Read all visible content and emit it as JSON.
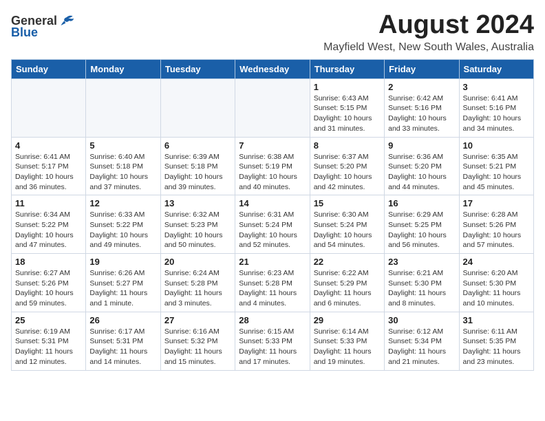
{
  "logo": {
    "general": "General",
    "blue": "Blue"
  },
  "title": "August 2024",
  "subtitle": "Mayfield West, New South Wales, Australia",
  "weekdays": [
    "Sunday",
    "Monday",
    "Tuesday",
    "Wednesday",
    "Thursday",
    "Friday",
    "Saturday"
  ],
  "weeks": [
    [
      {
        "day": "",
        "info": ""
      },
      {
        "day": "",
        "info": ""
      },
      {
        "day": "",
        "info": ""
      },
      {
        "day": "",
        "info": ""
      },
      {
        "day": "1",
        "info": "Sunrise: 6:43 AM\nSunset: 5:15 PM\nDaylight: 10 hours\nand 31 minutes."
      },
      {
        "day": "2",
        "info": "Sunrise: 6:42 AM\nSunset: 5:16 PM\nDaylight: 10 hours\nand 33 minutes."
      },
      {
        "day": "3",
        "info": "Sunrise: 6:41 AM\nSunset: 5:16 PM\nDaylight: 10 hours\nand 34 minutes."
      }
    ],
    [
      {
        "day": "4",
        "info": "Sunrise: 6:41 AM\nSunset: 5:17 PM\nDaylight: 10 hours\nand 36 minutes."
      },
      {
        "day": "5",
        "info": "Sunrise: 6:40 AM\nSunset: 5:18 PM\nDaylight: 10 hours\nand 37 minutes."
      },
      {
        "day": "6",
        "info": "Sunrise: 6:39 AM\nSunset: 5:18 PM\nDaylight: 10 hours\nand 39 minutes."
      },
      {
        "day": "7",
        "info": "Sunrise: 6:38 AM\nSunset: 5:19 PM\nDaylight: 10 hours\nand 40 minutes."
      },
      {
        "day": "8",
        "info": "Sunrise: 6:37 AM\nSunset: 5:20 PM\nDaylight: 10 hours\nand 42 minutes."
      },
      {
        "day": "9",
        "info": "Sunrise: 6:36 AM\nSunset: 5:20 PM\nDaylight: 10 hours\nand 44 minutes."
      },
      {
        "day": "10",
        "info": "Sunrise: 6:35 AM\nSunset: 5:21 PM\nDaylight: 10 hours\nand 45 minutes."
      }
    ],
    [
      {
        "day": "11",
        "info": "Sunrise: 6:34 AM\nSunset: 5:22 PM\nDaylight: 10 hours\nand 47 minutes."
      },
      {
        "day": "12",
        "info": "Sunrise: 6:33 AM\nSunset: 5:22 PM\nDaylight: 10 hours\nand 49 minutes."
      },
      {
        "day": "13",
        "info": "Sunrise: 6:32 AM\nSunset: 5:23 PM\nDaylight: 10 hours\nand 50 minutes."
      },
      {
        "day": "14",
        "info": "Sunrise: 6:31 AM\nSunset: 5:24 PM\nDaylight: 10 hours\nand 52 minutes."
      },
      {
        "day": "15",
        "info": "Sunrise: 6:30 AM\nSunset: 5:24 PM\nDaylight: 10 hours\nand 54 minutes."
      },
      {
        "day": "16",
        "info": "Sunrise: 6:29 AM\nSunset: 5:25 PM\nDaylight: 10 hours\nand 56 minutes."
      },
      {
        "day": "17",
        "info": "Sunrise: 6:28 AM\nSunset: 5:26 PM\nDaylight: 10 hours\nand 57 minutes."
      }
    ],
    [
      {
        "day": "18",
        "info": "Sunrise: 6:27 AM\nSunset: 5:26 PM\nDaylight: 10 hours\nand 59 minutes."
      },
      {
        "day": "19",
        "info": "Sunrise: 6:26 AM\nSunset: 5:27 PM\nDaylight: 11 hours\nand 1 minute."
      },
      {
        "day": "20",
        "info": "Sunrise: 6:24 AM\nSunset: 5:28 PM\nDaylight: 11 hours\nand 3 minutes."
      },
      {
        "day": "21",
        "info": "Sunrise: 6:23 AM\nSunset: 5:28 PM\nDaylight: 11 hours\nand 4 minutes."
      },
      {
        "day": "22",
        "info": "Sunrise: 6:22 AM\nSunset: 5:29 PM\nDaylight: 11 hours\nand 6 minutes."
      },
      {
        "day": "23",
        "info": "Sunrise: 6:21 AM\nSunset: 5:30 PM\nDaylight: 11 hours\nand 8 minutes."
      },
      {
        "day": "24",
        "info": "Sunrise: 6:20 AM\nSunset: 5:30 PM\nDaylight: 11 hours\nand 10 minutes."
      }
    ],
    [
      {
        "day": "25",
        "info": "Sunrise: 6:19 AM\nSunset: 5:31 PM\nDaylight: 11 hours\nand 12 minutes."
      },
      {
        "day": "26",
        "info": "Sunrise: 6:17 AM\nSunset: 5:31 PM\nDaylight: 11 hours\nand 14 minutes."
      },
      {
        "day": "27",
        "info": "Sunrise: 6:16 AM\nSunset: 5:32 PM\nDaylight: 11 hours\nand 15 minutes."
      },
      {
        "day": "28",
        "info": "Sunrise: 6:15 AM\nSunset: 5:33 PM\nDaylight: 11 hours\nand 17 minutes."
      },
      {
        "day": "29",
        "info": "Sunrise: 6:14 AM\nSunset: 5:33 PM\nDaylight: 11 hours\nand 19 minutes."
      },
      {
        "day": "30",
        "info": "Sunrise: 6:12 AM\nSunset: 5:34 PM\nDaylight: 11 hours\nand 21 minutes."
      },
      {
        "day": "31",
        "info": "Sunrise: 6:11 AM\nSunset: 5:35 PM\nDaylight: 11 hours\nand 23 minutes."
      }
    ]
  ]
}
